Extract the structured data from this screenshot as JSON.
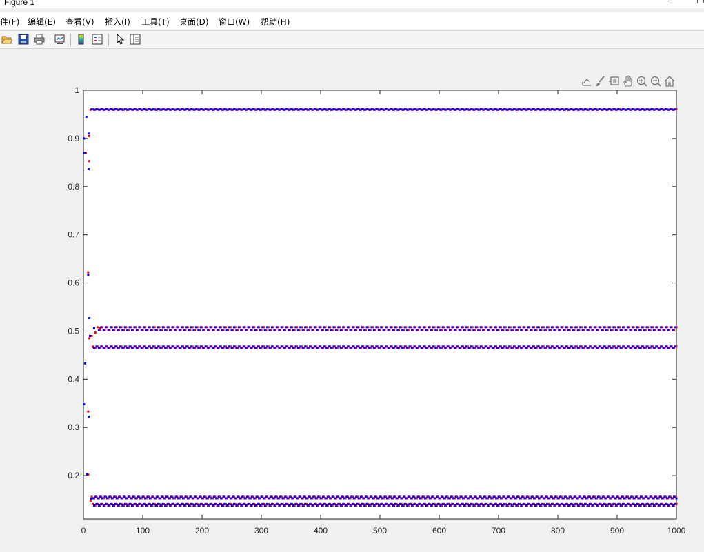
{
  "window": {
    "title": "Figure 1",
    "minimize_icon": "minimize-icon",
    "close_icon": "close-icon"
  },
  "menubar": {
    "items": [
      {
        "label": "件(F)"
      },
      {
        "label": "编辑(E)"
      },
      {
        "label": "查看(V)"
      },
      {
        "label": "插入(I)"
      },
      {
        "label": "工具(T)"
      },
      {
        "label": "桌面(D)"
      },
      {
        "label": "窗口(W)"
      },
      {
        "label": "帮助(H)"
      }
    ]
  },
  "toolbar": {
    "icons": [
      "open-file-icon",
      "save-icon",
      "print-icon",
      "link-plot-icon",
      "colorbar-icon",
      "legend-icon",
      "pointer-icon",
      "property-editor-icon"
    ]
  },
  "axes_toolbar": {
    "icons": [
      "export-icon",
      "brush-icon",
      "data-tips-icon",
      "pan-icon",
      "zoom-in-icon",
      "zoom-out-icon",
      "home-icon"
    ]
  },
  "chart_data": {
    "type": "scatter",
    "title": "",
    "xlabel": "",
    "ylabel": "",
    "xlim": [
      0,
      1000
    ],
    "ylim": [
      0.11,
      1.0
    ],
    "x_ticks": [
      "0",
      "100",
      "200",
      "300",
      "400",
      "500",
      "600",
      "700",
      "800",
      "900",
      "1000"
    ],
    "y_ticks": [
      "0.2",
      "0.3",
      "0.4",
      "0.5",
      "0.6",
      "0.7",
      "0.8",
      "0.9",
      "1"
    ],
    "grid": false,
    "box": true,
    "marker_size": 3,
    "series": [
      {
        "color": "#ff0000",
        "transient": [
          {
            "x": 4,
            "y": 0.87
          },
          {
            "x": 8,
            "y": 0.622
          },
          {
            "x": 8,
            "y": 0.333
          },
          {
            "x": 8,
            "y": 0.202
          },
          {
            "x": 9,
            "y": 0.905
          },
          {
            "x": 9,
            "y": 0.853
          },
          {
            "x": 10,
            "y": 0.485
          },
          {
            "x": 12,
            "y": 0.148
          },
          {
            "x": 14,
            "y": 0.49
          },
          {
            "x": 16,
            "y": 0.467
          },
          {
            "x": 20,
            "y": 0.497
          },
          {
            "x": 28,
            "y": 0.506
          }
        ],
        "bands": [
          {
            "y_even": 0.9596,
            "y_odd": 0.961,
            "from": 12,
            "to": 1000,
            "step": 4
          },
          {
            "y_even": 0.508,
            "y_odd": 0.502,
            "from": 24,
            "to": 1000,
            "step": 4
          },
          {
            "y_even": 0.468,
            "y_odd": 0.465,
            "from": 16,
            "to": 1000,
            "step": 4
          },
          {
            "y_even": 0.156,
            "y_odd": 0.153,
            "from": 14,
            "to": 1000,
            "step": 4
          },
          {
            "y_even": 0.141,
            "y_odd": 0.138,
            "from": 16,
            "to": 1000,
            "step": 4
          }
        ]
      },
      {
        "color": "#0000ff",
        "transient": [
          {
            "x": 1,
            "y": 0.9
          },
          {
            "x": 2,
            "y": 0.87
          },
          {
            "x": 1,
            "y": 0.348
          },
          {
            "x": 3,
            "y": 0.433
          },
          {
            "x": 5,
            "y": 0.945
          },
          {
            "x": 6,
            "y": 0.203
          },
          {
            "x": 8,
            "y": 0.617
          },
          {
            "x": 9,
            "y": 0.91
          },
          {
            "x": 9,
            "y": 0.836
          },
          {
            "x": 9,
            "y": 0.322
          },
          {
            "x": 10,
            "y": 0.527
          },
          {
            "x": 11,
            "y": 0.49
          },
          {
            "x": 13,
            "y": 0.152
          },
          {
            "x": 18,
            "y": 0.506
          }
        ],
        "bands": [
          {
            "y_even": 0.961,
            "y_odd": 0.9596,
            "from": 14,
            "to": 1000,
            "step": 4
          },
          {
            "y_even": 0.502,
            "y_odd": 0.508,
            "from": 26,
            "to": 1000,
            "step": 4
          },
          {
            "y_even": 0.465,
            "y_odd": 0.468,
            "from": 18,
            "to": 1000,
            "step": 4
          },
          {
            "y_even": 0.153,
            "y_odd": 0.156,
            "from": 16,
            "to": 1000,
            "step": 4
          },
          {
            "y_even": 0.138,
            "y_odd": 0.141,
            "from": 18,
            "to": 1000,
            "step": 4
          }
        ]
      }
    ]
  }
}
